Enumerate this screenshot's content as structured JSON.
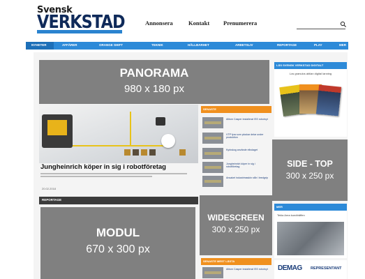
{
  "logo": {
    "line1": "Svensk",
    "line2": "VERKSTAD"
  },
  "topnav": [
    "Annonsera",
    "Kontakt",
    "Prenumerera"
  ],
  "mainnav": [
    "NYHETER",
    "AFFÄRER",
    "ORANGE SHIFT",
    "TEKNIK",
    "HÅLLBARHET",
    "ARBETSLIV",
    "REPORTAGE",
    "PLAY",
    "MER"
  ],
  "article": {
    "headline": "Jungheinrich köper in sig i robotföretag",
    "meta": "20.02.2018"
  },
  "section_bar": "REPORTAGE",
  "right_news": {
    "header": "SENASTE",
    "items": [
      "Alltom Casper installerat ISS robotnyt",
      "VTP fyra som plockar delar under produktion",
      "Kyrkskog använde elbolaget",
      "Jungheinrich köper in sig i robotföretag",
      "Ansaket industrimaskin står i bredgrip"
    ]
  },
  "right_news2": {
    "header": "SENASTE MEST LÄSTA",
    "items": [
      "Alltom Casper installerat ISS robotnyt"
    ]
  },
  "side_top_card": {
    "header": "LÄS SVENSK VERKSTAD DIGITALT",
    "caption": "Los granulos ablian digital lanning"
  },
  "side_mid_card": {
    "header": "MER",
    "caption": "Tekla Area kundträffen"
  },
  "demag": {
    "brand": "DEMAG",
    "tagline": "REPRESENTANT"
  },
  "ads": {
    "panorama": {
      "name": "PANORAMA",
      "size": "980 x 180 px"
    },
    "side_top": {
      "name": "SIDE - TOP",
      "size": "300 x 250 px"
    },
    "widescreen": {
      "name": "WIDESCREEN",
      "size": "300 x 250 px"
    },
    "modul": {
      "name": "MODUL",
      "size": "670 x 300 px"
    }
  },
  "colors": {
    "nav_blue": "#2d8ad8",
    "accent_orange": "#f0901e",
    "ad_gray": "#808080",
    "logo_navy": "#0f2a5a"
  }
}
